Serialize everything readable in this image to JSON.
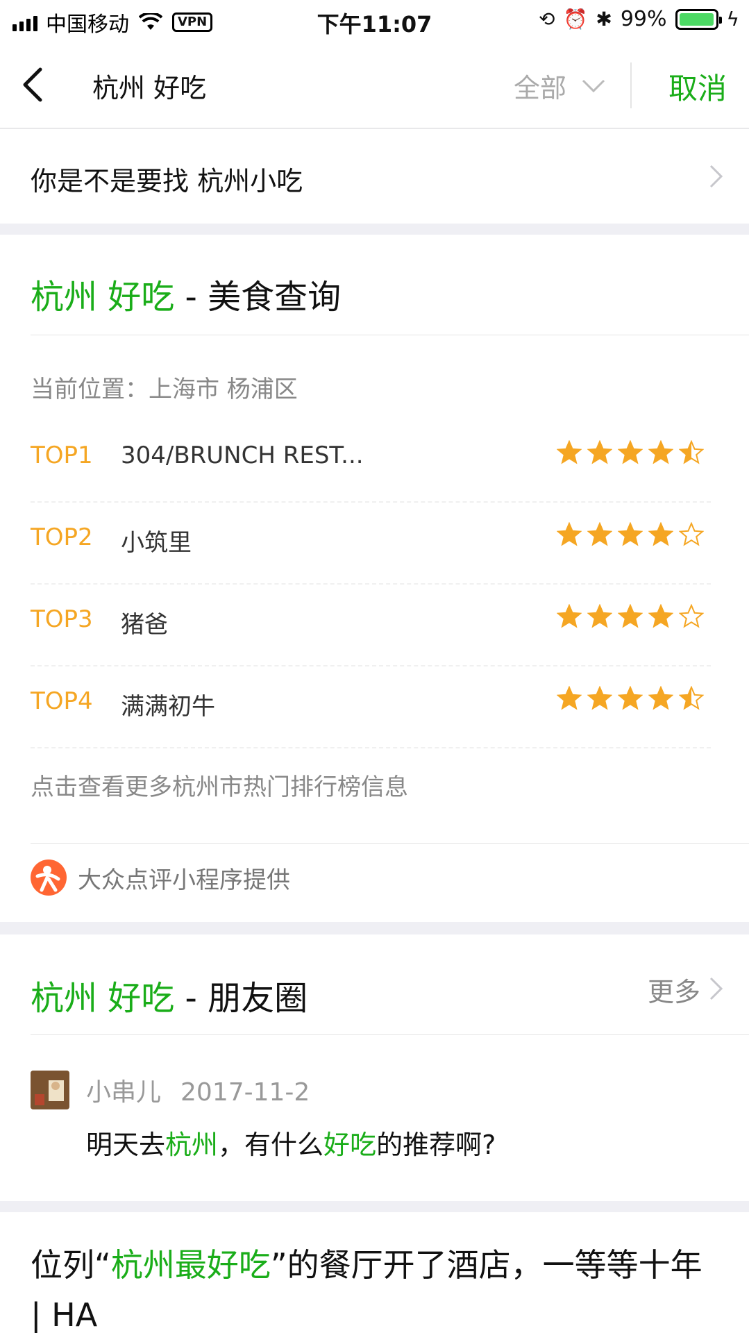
{
  "status_bar": {
    "carrier": "中国移动",
    "vpn": "VPN",
    "time": "下午11:07",
    "battery": "99%",
    "battery_level": 0.99
  },
  "navbar": {
    "query": "杭州 好吃",
    "filter": "全部",
    "cancel": "取消"
  },
  "suggestion": {
    "text": "你是不是要找 杭州小吃"
  },
  "food": {
    "title_keyword": "杭州 好吃",
    "title_suffix": " - 美食查询",
    "location": "当前位置：上海市 杨浦区",
    "rankings": [
      {
        "rank": "TOP1",
        "name": "304/BRUNCH REST...",
        "rating": 4.5
      },
      {
        "rank": "TOP2",
        "name": "小筑里",
        "rating": 4
      },
      {
        "rank": "TOP3",
        "name": "猪爸",
        "rating": 4
      },
      {
        "rank": "TOP4",
        "name": "满满初牛",
        "rating": 4.5
      }
    ],
    "more": "点击查看更多杭州市热门排行榜信息",
    "provider": "大众点评小程序提供"
  },
  "moments": {
    "title_keyword": "杭州 好吃",
    "title_suffix": " - 朋友圈",
    "more": "更多",
    "post": {
      "author": "小串儿",
      "date": "2017-11-2",
      "body_1": "明天去",
      "body_hl_1": "杭州",
      "body_2": "，有什么",
      "body_hl_2": "好吃",
      "body_3": "的推荐啊?"
    }
  },
  "article": {
    "prefix": "位列“",
    "keyword": "杭州最好吃",
    "suffix": "”的餐厅开了酒店，一等等十年 | HA"
  },
  "colors": {
    "accent": "#1aad19",
    "rank": "#f5a623",
    "star": "#f5a623"
  }
}
